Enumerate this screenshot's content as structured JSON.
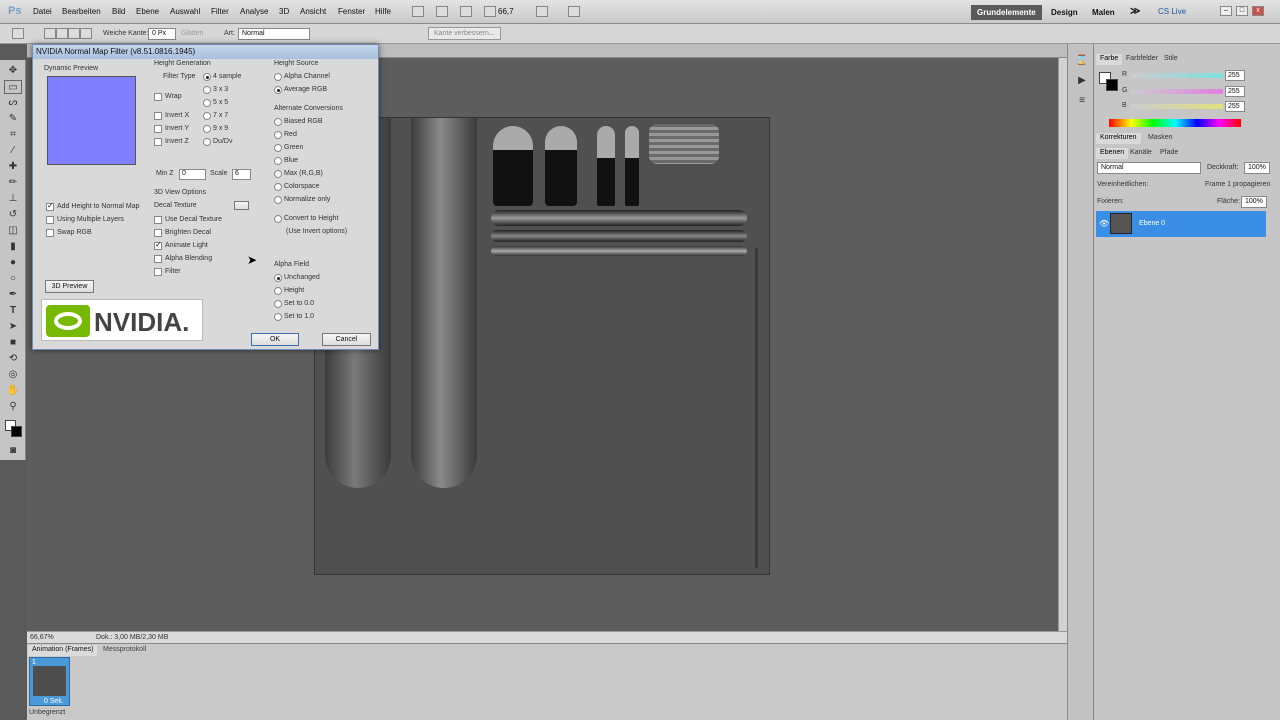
{
  "app": {
    "logo": "Ps"
  },
  "menu": [
    "Datei",
    "Bearbeiten",
    "Bild",
    "Ebene",
    "Auswahl",
    "Filter",
    "Analyse",
    "3D",
    "Ansicht",
    "Fenster",
    "Hilfe"
  ],
  "menubar": {
    "zoom": "66,7",
    "workspaces": [
      "Grundelemente",
      "Design",
      "Malen"
    ],
    "more": "≫",
    "cs_live": "CS Live"
  },
  "options": {
    "feather_label": "Weiche Kante:",
    "feather_value": "0 Px",
    "antialias": "Glätten",
    "style_label": "Art:",
    "style_value": "Normal",
    "refine_edge": "Kante verbessern..."
  },
  "status": {
    "zoom": "66,67%",
    "doc": "Dok.: 3,00 MB/2,30 MB"
  },
  "animation": {
    "tabs": [
      "Animation (Frames)",
      "Messprotokoll"
    ],
    "frame_number": "1",
    "frame_delay": "0 Sek.",
    "loop": "Unbegrenzt"
  },
  "panels": {
    "color_tabs": [
      "Farbe",
      "Farbfelder",
      "Stile"
    ],
    "channels": [
      {
        "label": "R",
        "value": "255",
        "color": "#7fe0e0"
      },
      {
        "label": "G",
        "value": "255",
        "color": "#e07fe0"
      },
      {
        "label": "B",
        "value": "255",
        "color": "#e0e07f"
      }
    ],
    "adjust_tabs": [
      "Korrekturen",
      "Masken"
    ],
    "layer_tabs": [
      "Ebenen",
      "Kanäle",
      "Pfade"
    ],
    "blend_mode": "Normal",
    "opacity_label": "Deckkraft:",
    "opacity": "100%",
    "unify_label": "Vereinheitlichen:",
    "propagate": "Frame 1 propagieren",
    "lock_label": "Fixieren:",
    "fill_label": "Fläche:",
    "fill": "100%",
    "layer_name": "Ebene 0"
  },
  "dialog": {
    "title": "NVIDIA Normal Map Filter (v8.51.0816.1945)",
    "preview_label": "Dynamic Preview",
    "preview_color": "#7f7fff",
    "height_generation": "Height Generation",
    "filter_type": "Filter Type",
    "filter_options": [
      "4 sample",
      "3 x 3",
      "5 x 5",
      "7 x 7",
      "9 x 9",
      "Du/Dv"
    ],
    "wrap": "Wrap",
    "invert_x": "Invert X",
    "invert_y": "Invert Y",
    "invert_z": "Invert Z",
    "min_z": "Min Z",
    "min_z_value": "0",
    "scale": "Scale",
    "scale_value": "6",
    "add_height": "Add Height to Normal Map",
    "multiple_layers": "Using Multiple Layers",
    "swap_rgb": "Swap RGB",
    "view3d_options": "3D View Options",
    "decal_texture": "Decal Texture",
    "use_decal": "Use Decal Texture",
    "brighten_decal": "Brighten Decal",
    "animate_light": "Animate Light",
    "alpha_blending": "Alpha Blending",
    "filter": "Filter",
    "preview3d": "3D Preview",
    "height_source": "Height Source",
    "alpha_channel": "Alpha Channel",
    "average_rgb": "Average RGB",
    "alternate_conversions": "Alternate Conversions",
    "conversions": [
      "Biased RGB",
      "Red",
      "Green",
      "Blue",
      "Max (R,G,B)",
      "Colorspace",
      "Normalize only"
    ],
    "convert_to_height": "Convert to Height",
    "use_invert": "(Use Invert options)",
    "alpha_field": "Alpha Field",
    "alpha_options": [
      "Unchanged",
      "Height",
      "Set to 0.0",
      "Set to 1.0"
    ],
    "logo_text": "NVIDIA.",
    "ok": "OK",
    "cancel": "Cancel"
  }
}
